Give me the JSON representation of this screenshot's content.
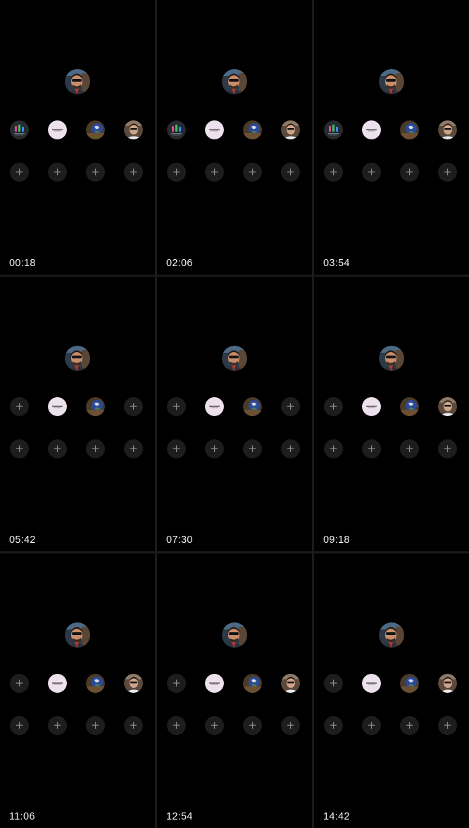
{
  "frames": [
    {
      "timestamp": "00:18",
      "top_row": [
        "stats-thumbnail",
        "note-thumbnail",
        "earth-thumbnail",
        "person-thumbnail"
      ]
    },
    {
      "timestamp": "02:06",
      "top_row": [
        "stats-thumbnail",
        "note-thumbnail",
        "earth-thumbnail",
        "person-thumbnail"
      ]
    },
    {
      "timestamp": "03:54",
      "top_row": [
        "stats-thumbnail",
        "note-thumbnail",
        "earth-thumbnail",
        "person-thumbnail"
      ]
    },
    {
      "timestamp": "05:42",
      "top_row": [
        "empty",
        "note-thumbnail",
        "earth-thumbnail",
        "empty"
      ]
    },
    {
      "timestamp": "07:30",
      "top_row": [
        "empty",
        "note-thumbnail",
        "earth-thumbnail",
        "empty"
      ]
    },
    {
      "timestamp": "09:18",
      "top_row": [
        "empty",
        "note-thumbnail",
        "earth-thumbnail",
        "person-thumbnail"
      ]
    },
    {
      "timestamp": "11:06",
      "top_row": [
        "empty",
        "note-thumbnail",
        "earth-thumbnail",
        "person-thumbnail"
      ]
    },
    {
      "timestamp": "12:54",
      "top_row": [
        "empty",
        "note-thumbnail",
        "earth-thumbnail",
        "person-thumbnail"
      ]
    },
    {
      "timestamp": "14:42",
      "top_row": [
        "empty",
        "note-thumbnail",
        "earth-thumbnail",
        "person-thumbnail"
      ]
    }
  ],
  "add_slot": {
    "icon": "plus-icon",
    "glyph": "+"
  },
  "profile": {
    "icon": "profile-avatar"
  },
  "colors": {
    "background": "#000000",
    "divider": "#1a1a1a",
    "slot": "#1d1d1d",
    "plus": "#8a8a8a",
    "timestamp": "#f2f2f2"
  }
}
